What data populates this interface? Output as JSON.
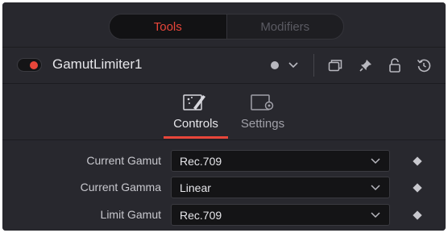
{
  "tabs": {
    "tools_label": "Tools",
    "modifiers_label": "Modifiers"
  },
  "node": {
    "name": "GamutLimiter1",
    "enabled": true
  },
  "sub_tabs": {
    "controls_label": "Controls",
    "settings_label": "Settings"
  },
  "params": [
    {
      "label": "Current Gamut",
      "value": "Rec.709"
    },
    {
      "label": "Current Gamma",
      "value": "Linear"
    },
    {
      "label": "Limit Gamut",
      "value": "Rec.709"
    }
  ],
  "colors": {
    "accent": "#e8463a",
    "panel_bg": "#28282e",
    "field_bg": "#141416"
  }
}
